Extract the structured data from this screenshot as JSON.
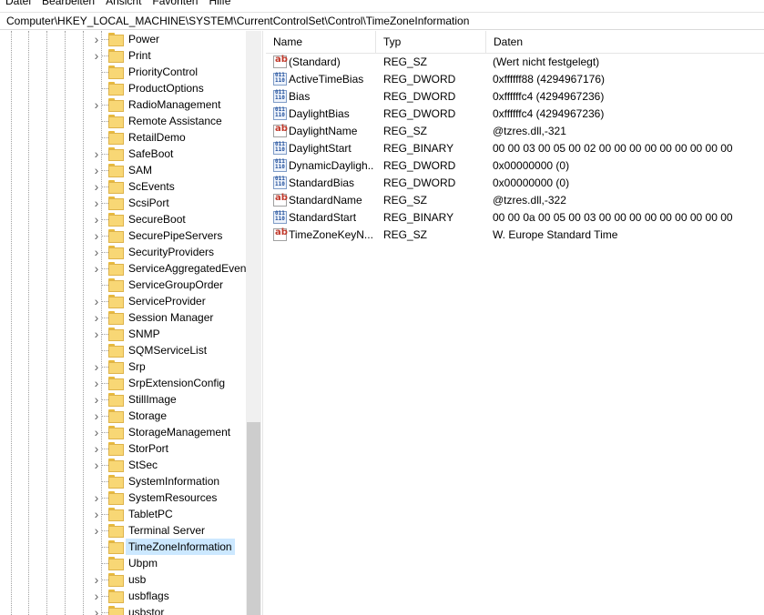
{
  "menu": [
    "Datei",
    "Bearbeiten",
    "Ansicht",
    "Favoriten",
    "Hilfe"
  ],
  "address": "Computer\\HKEY_LOCAL_MACHINE\\SYSTEM\\CurrentControlSet\\Control\\TimeZoneInformation",
  "tree": {
    "items": [
      {
        "label": "Power",
        "expandable": true
      },
      {
        "label": "Print",
        "expandable": true
      },
      {
        "label": "PriorityControl",
        "expandable": false
      },
      {
        "label": "ProductOptions",
        "expandable": false
      },
      {
        "label": "RadioManagement",
        "expandable": true
      },
      {
        "label": "Remote Assistance",
        "expandable": false
      },
      {
        "label": "RetailDemo",
        "expandable": false
      },
      {
        "label": "SafeBoot",
        "expandable": true
      },
      {
        "label": "SAM",
        "expandable": true
      },
      {
        "label": "ScEvents",
        "expandable": true
      },
      {
        "label": "ScsiPort",
        "expandable": true
      },
      {
        "label": "SecureBoot",
        "expandable": true
      },
      {
        "label": "SecurePipeServers",
        "expandable": true
      },
      {
        "label": "SecurityProviders",
        "expandable": true
      },
      {
        "label": "ServiceAggregatedEvents",
        "expandable": true
      },
      {
        "label": "ServiceGroupOrder",
        "expandable": false
      },
      {
        "label": "ServiceProvider",
        "expandable": true
      },
      {
        "label": "Session Manager",
        "expandable": true
      },
      {
        "label": "SNMP",
        "expandable": true
      },
      {
        "label": "SQMServiceList",
        "expandable": false
      },
      {
        "label": "Srp",
        "expandable": true
      },
      {
        "label": "SrpExtensionConfig",
        "expandable": true
      },
      {
        "label": "StillImage",
        "expandable": true
      },
      {
        "label": "Storage",
        "expandable": true
      },
      {
        "label": "StorageManagement",
        "expandable": true
      },
      {
        "label": "StorPort",
        "expandable": true
      },
      {
        "label": "StSec",
        "expandable": true
      },
      {
        "label": "SystemInformation",
        "expandable": false
      },
      {
        "label": "SystemResources",
        "expandable": true
      },
      {
        "label": "TabletPC",
        "expandable": true
      },
      {
        "label": "Terminal Server",
        "expandable": true
      },
      {
        "label": "TimeZoneInformation",
        "expandable": false,
        "selected": true
      },
      {
        "label": "Ubpm",
        "expandable": false
      },
      {
        "label": "usb",
        "expandable": true
      },
      {
        "label": "usbflags",
        "expandable": true
      },
      {
        "label": "usbstor",
        "expandable": true
      }
    ]
  },
  "list": {
    "columns": [
      "Name",
      "Typ",
      "Daten"
    ],
    "rows": [
      {
        "icon": "string-value-icon",
        "kind": "sz",
        "name": "(Standard)",
        "type": "REG_SZ",
        "data": "(Wert nicht festgelegt)"
      },
      {
        "icon": "binary-value-icon",
        "kind": "bin",
        "name": "ActiveTimeBias",
        "type": "REG_DWORD",
        "data": "0xffffff88 (4294967176)"
      },
      {
        "icon": "binary-value-icon",
        "kind": "bin",
        "name": "Bias",
        "type": "REG_DWORD",
        "data": "0xffffffc4 (4294967236)"
      },
      {
        "icon": "binary-value-icon",
        "kind": "bin",
        "name": "DaylightBias",
        "type": "REG_DWORD",
        "data": "0xffffffc4 (4294967236)"
      },
      {
        "icon": "string-value-icon",
        "kind": "sz",
        "name": "DaylightName",
        "type": "REG_SZ",
        "data": "@tzres.dll,-321"
      },
      {
        "icon": "binary-value-icon",
        "kind": "bin",
        "name": "DaylightStart",
        "type": "REG_BINARY",
        "data": "00 00 03 00 05 00 02 00 00 00 00 00 00 00 00 00"
      },
      {
        "icon": "binary-value-icon",
        "kind": "bin",
        "name": "DynamicDayligh...",
        "type": "REG_DWORD",
        "data": "0x00000000 (0)"
      },
      {
        "icon": "binary-value-icon",
        "kind": "bin",
        "name": "StandardBias",
        "type": "REG_DWORD",
        "data": "0x00000000 (0)"
      },
      {
        "icon": "string-value-icon",
        "kind": "sz",
        "name": "StandardName",
        "type": "REG_SZ",
        "data": "@tzres.dll,-322"
      },
      {
        "icon": "binary-value-icon",
        "kind": "bin",
        "name": "StandardStart",
        "type": "REG_BINARY",
        "data": "00 00 0a 00 05 00 03 00 00 00 00 00 00 00 00 00"
      },
      {
        "icon": "string-value-icon",
        "kind": "sz",
        "name": "TimeZoneKeyN...",
        "type": "REG_SZ",
        "data": "W. Europe Standard Time"
      }
    ]
  }
}
